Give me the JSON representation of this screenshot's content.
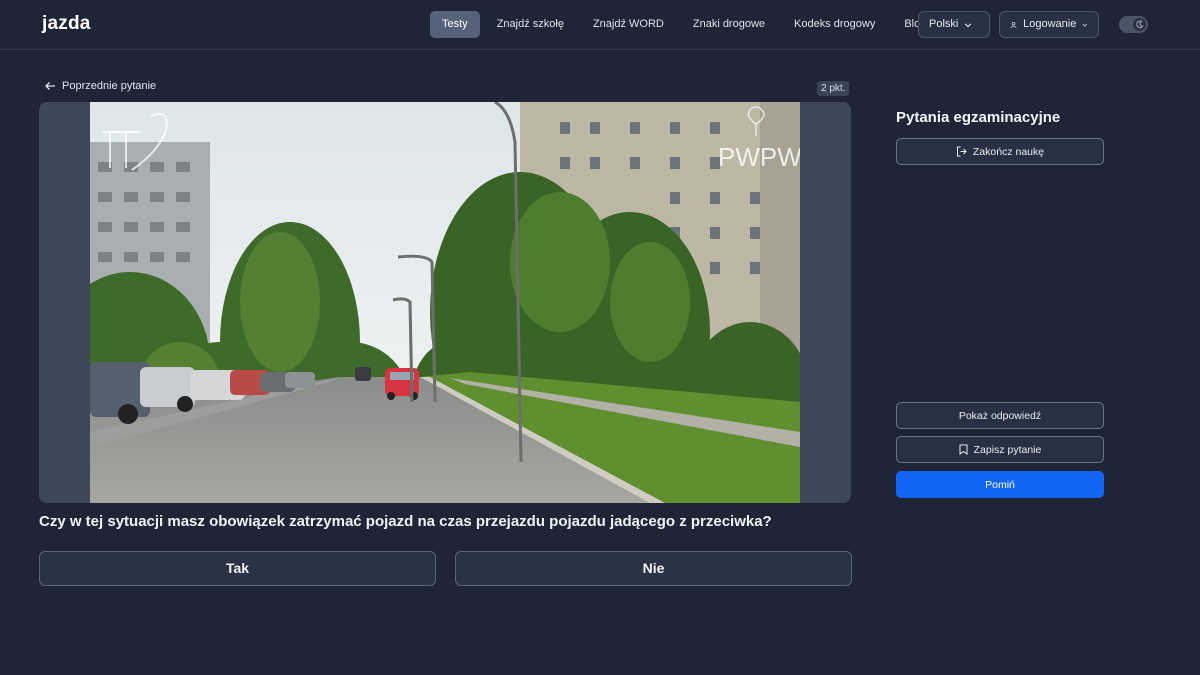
{
  "nav": {
    "logo": "jazda",
    "links": [
      {
        "label": "Testy",
        "active": true
      },
      {
        "label": "Znajdź szkołę"
      },
      {
        "label": "Znajdź WORD"
      },
      {
        "label": "Znaki drogowe"
      },
      {
        "label": "Kodeks drogowy"
      },
      {
        "label": "Blog"
      }
    ],
    "language": "Polski",
    "login": "Logowanie"
  },
  "question_panel": {
    "prev_label": "Poprzednie pytanie",
    "points": "2 pkt.",
    "watermark": "PWPW",
    "question": "Czy w tej sytuacji masz obowiązek zatrzymać pojazd na czas przejazdu pojazdu jadącego z przeciwka?",
    "answers": [
      "Tak",
      "Nie"
    ]
  },
  "sidebar": {
    "title": "Pytania egzaminacyjne",
    "end_label": "Zakończ naukę",
    "show_answer": "Pokaż odpowiedź",
    "save_question": "Zapisz pytanie",
    "skip": "Pomiń"
  },
  "colors": {
    "background": "#1e2536",
    "primary": "#1266f1",
    "active_tab": "#56627a"
  }
}
